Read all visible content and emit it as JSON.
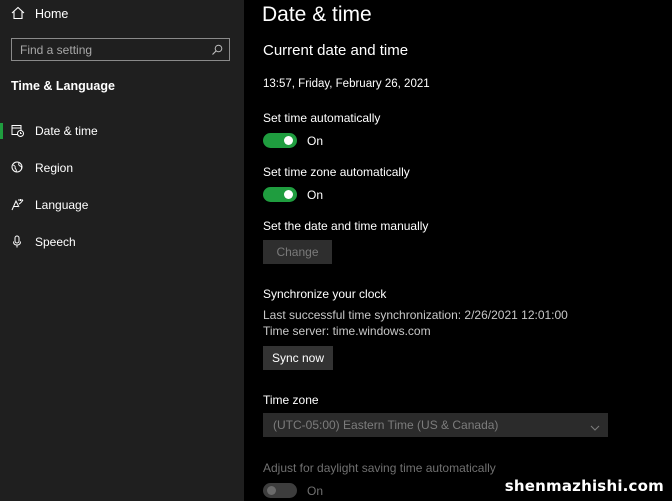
{
  "sidebar": {
    "home_label": "Home",
    "search_placeholder": "Find a setting",
    "section_title": "Time & Language",
    "items": [
      {
        "label": "Date & time",
        "icon": "calendar-clock-icon",
        "selected": true
      },
      {
        "label": "Region",
        "icon": "globe-icon",
        "selected": false
      },
      {
        "label": "Language",
        "icon": "language-icon",
        "selected": false
      },
      {
        "label": "Speech",
        "icon": "microphone-icon",
        "selected": false
      }
    ],
    "accent_color": "#1f9d3f"
  },
  "main": {
    "title": "Date & time",
    "current_heading": "Current date and time",
    "current_datetime": "13:57, Friday, February 26, 2021",
    "auto_time": {
      "label": "Set time automatically",
      "state": "On"
    },
    "auto_timezone": {
      "label": "Set time zone automatically",
      "state": "On"
    },
    "manual": {
      "label": "Set the date and time manually",
      "button": "Change"
    },
    "sync": {
      "heading": "Synchronize your clock",
      "last_sync": "Last successful time synchronization: 2/26/2021 12:01:00",
      "server": "Time server: time.windows.com",
      "button": "Sync now"
    },
    "timezone": {
      "label": "Time zone",
      "value": "(UTC-05:00) Eastern Time (US & Canada)"
    },
    "daylight": {
      "label": "Adjust for daylight saving time automatically",
      "state": "On"
    }
  },
  "watermark": "shenmazhishi.com"
}
